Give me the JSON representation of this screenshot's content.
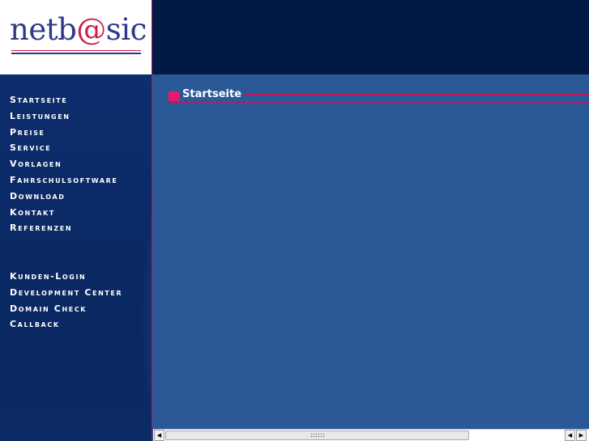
{
  "logo": {
    "text_before": "netb",
    "at": "@",
    "text_after": "sic"
  },
  "menu_main": [
    "Startseite",
    "Leistungen",
    "Preise",
    "Service",
    "Vorlagen",
    "Fahrschulsoftware",
    "Download",
    "Kontakt",
    "Referenzen"
  ],
  "menu_secondary": [
    "Kunden-Login",
    "Development Center",
    "Domain Check",
    "Callback"
  ],
  "content": {
    "title": "Startseite"
  },
  "scrollbar": {
    "left_arrow": "◀",
    "right_arrow": "▶"
  },
  "colors": {
    "banner": "#001a45",
    "sidebar": "#0c2d6e",
    "content": "#2b5896",
    "accent": "#e8186e",
    "logo_blue": "#2d3a8c"
  }
}
